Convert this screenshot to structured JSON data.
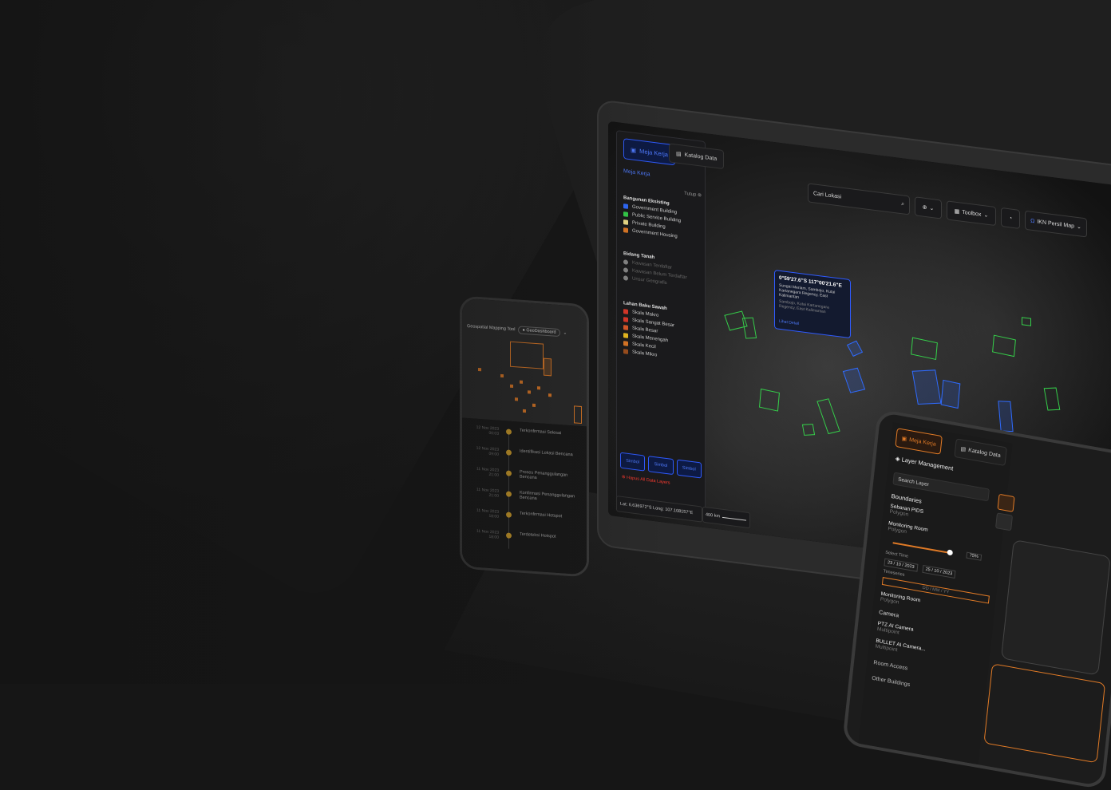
{
  "laptop": {
    "tabs": [
      {
        "label": "Meja Kerja",
        "active": true
      },
      {
        "label": "Katalog Data",
        "active": false
      }
    ],
    "panel_title": "Meja Kerja",
    "close_label": "Tutup",
    "groups": [
      {
        "title": "Bangunan Eksisting",
        "items": [
          {
            "label": "Government Building",
            "color": "#2f6bff"
          },
          {
            "label": "Public Service Building",
            "color": "#35d04a"
          },
          {
            "label": "Private Building",
            "color": "#f0e08a"
          },
          {
            "label": "Government Housing",
            "color": "#e07a26"
          }
        ]
      },
      {
        "title": "Bidang Tanah",
        "items": [
          {
            "label": "Kawasan Terdaftar",
            "color": "#888888"
          },
          {
            "label": "Kawasan Belum Terdaftar",
            "color": "#888888"
          },
          {
            "label": "Unsur Geografis",
            "color": "#888888"
          }
        ]
      },
      {
        "title": "Lahan Baku Sawah",
        "items": [
          {
            "label": "Skala Makro",
            "color": "#e0392a"
          },
          {
            "label": "Skala Sangat Besar",
            "color": "#e0392a"
          },
          {
            "label": "Skala Besar",
            "color": "#e05a2a"
          },
          {
            "label": "Skala Menengah",
            "color": "#f0c020"
          },
          {
            "label": "Skala Kecil",
            "color": "#e07a26"
          },
          {
            "label": "Skala Mikro",
            "color": "#a0501e"
          }
        ]
      }
    ],
    "bottom_buttons": [
      "Simbol",
      "Simbol",
      "Simbol"
    ],
    "remove_label": "Hapus All Data Layers",
    "coord_text": "Lat: 6.636972°S Long: 107.108157°E",
    "scale_text": "400 km",
    "search_placeholder": "Cari Lokasi",
    "toolbox_label": "Toolbox",
    "map_select": "IKN Persil Map",
    "popup": {
      "coords": "0°59'27.6\"S 117°00'21.6\"E",
      "address": "Sungai Meriam, Sambojo, Kutai Kartanegara Regency, East Kalimantan",
      "address2": "Sambojo, Kutai Kartanegara Regency, East Kalimantan",
      "link": "Lihat Detail"
    },
    "accent": "#2f5bff",
    "polygon_color": "#35d04a"
  },
  "phone": {
    "app_title": "Geospatial Mapping Tool",
    "chip": "GeoDashboard",
    "timeline": [
      {
        "date": "12 Nov 2023",
        "time": "00:03",
        "label": "Terkonfirmasi Selesai"
      },
      {
        "date": "12 Nov 2023",
        "time": "09:00",
        "label": "Identifikasi Lokasi Bencana"
      },
      {
        "date": "11 Nov 2023",
        "time": "21:00",
        "label": "Proses Penanggulangan Bencana"
      },
      {
        "date": "11 Nov 2023",
        "time": "21:00",
        "label": "Konfirmasi Penanggulangan Bencana"
      },
      {
        "date": "11 Nov 2023",
        "time": "18:00",
        "label": "Terkonfirmasi Hotspot"
      },
      {
        "date": "11 Nov 2023",
        "time": "18:00",
        "label": "Terdeteksi Hotspot"
      }
    ],
    "accent": "#e07a26"
  },
  "tablet": {
    "tabs": [
      {
        "label": "Meja Kerja",
        "active": true
      },
      {
        "label": "Katalog Data",
        "active": false
      }
    ],
    "title": "Layer Management",
    "search_placeholder": "Search Layer",
    "section_boundaries": "Boundaries",
    "boundary_items": [
      {
        "name": "Sebaran PIDS",
        "type": "Polygon"
      },
      {
        "name": "Monitoring Room",
        "type": "Polygon"
      }
    ],
    "opacity_value": "75%",
    "select_time": "Select Time",
    "date_from": "23 / 10 / 2023",
    "date_to": "25 / 10 / 2023",
    "time_label": "Timeseries",
    "date_placeholder": "DD / MM / YY",
    "monitoring": {
      "name": "Monitoring Room",
      "type": "Polygon"
    },
    "section_camera": "Camera",
    "camera_items": [
      {
        "name": "PTZ AI Camera",
        "type": "Multipoint"
      },
      {
        "name": "BULLET AI Camera...",
        "type": "Multipoint"
      }
    ],
    "section_room": "Room Access",
    "section_other": "Other Buildings",
    "accent": "#e07a26"
  }
}
